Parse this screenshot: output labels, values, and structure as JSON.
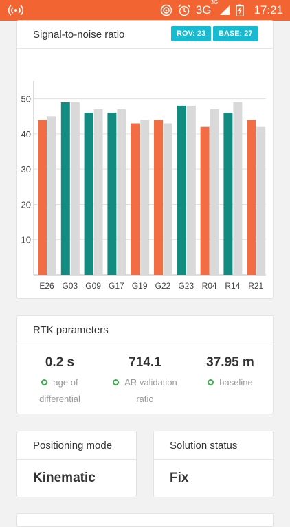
{
  "status_bar": {
    "network": "3G",
    "network_super": "3G",
    "time": "17:21",
    "background_color": "#f26533",
    "icons": [
      "broadcast-icon",
      "target-icon",
      "alarm-icon",
      "signal-icon",
      "battery-icon"
    ]
  },
  "snr_card": {
    "title": "Signal-to-noise ratio",
    "rov_badge": "ROV: 23",
    "base_badge": "BASE: 27"
  },
  "chart_data": {
    "type": "bar",
    "title": "Signal-to-noise ratio",
    "categories": [
      "E26",
      "G03",
      "G09",
      "G17",
      "G19",
      "G22",
      "G23",
      "R04",
      "R14",
      "R21"
    ],
    "series": [
      {
        "values": [
          44,
          49,
          46,
          46,
          43,
          44,
          48,
          42,
          46,
          44
        ],
        "colors": [
          "#f26c44",
          "#128b80",
          "#128b80",
          "#128b80",
          "#f26c44",
          "#f26c44",
          "#128b80",
          "#f26c44",
          "#128b80",
          "#f26c44"
        ]
      },
      {
        "values": [
          45,
          49,
          47,
          47,
          44,
          43,
          48,
          47,
          49,
          42
        ],
        "color": "#d9d9d9"
      }
    ],
    "y_ticks": [
      10,
      20,
      30,
      40,
      50
    ],
    "ylim": [
      0,
      55
    ],
    "grid": true
  },
  "rtk": {
    "title": "RTK parameters",
    "items": [
      {
        "value": "0.2 s",
        "label_line1": "age of",
        "label_line2": "differential"
      },
      {
        "value": "714.1",
        "label_line1": "AR validation",
        "label_line2": "ratio"
      },
      {
        "value": "37.95 m",
        "label_line1": "baseline",
        "label_line2": ""
      }
    ]
  },
  "positioning": {
    "title": "Positioning mode",
    "value": "Kinematic"
  },
  "solution": {
    "title": "Solution status",
    "value": "Fix"
  }
}
